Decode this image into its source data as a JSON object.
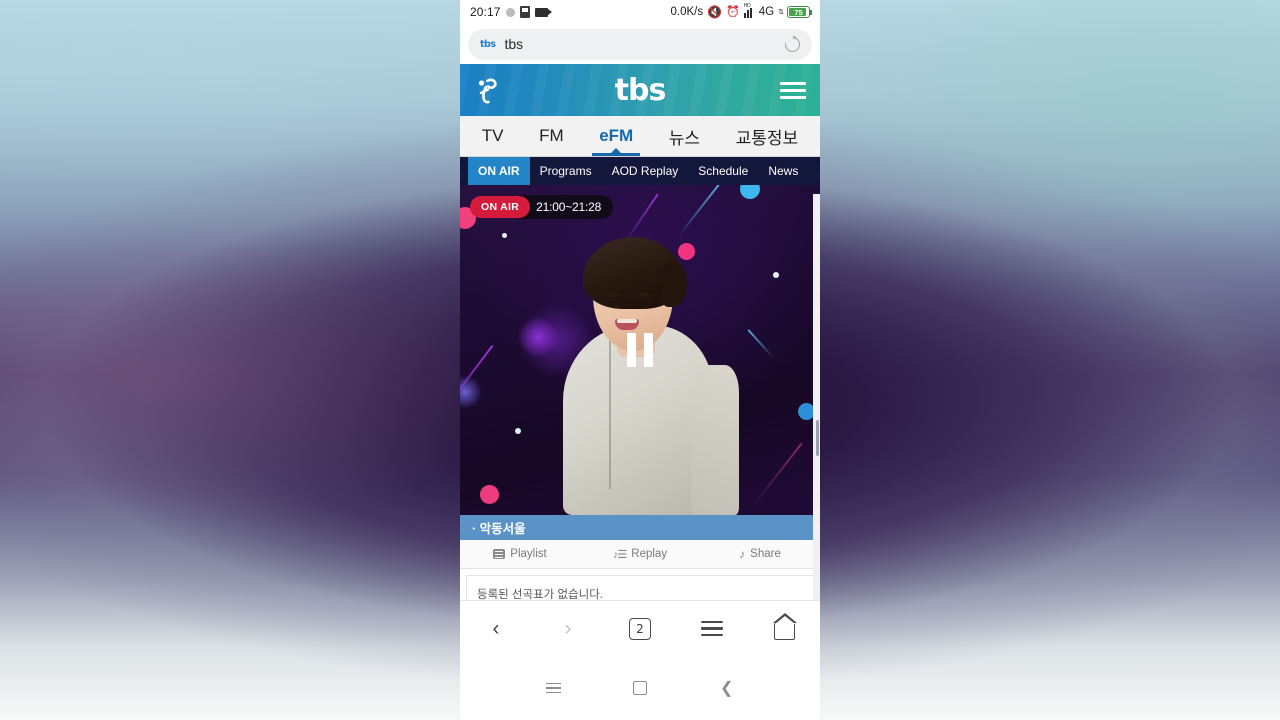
{
  "statusbar": {
    "clock": "20:17",
    "network_speed": "0.0K/s",
    "network_type": "4G",
    "battery_text": "75",
    "icons": [
      "record-dot-icon",
      "sd-card-icon",
      "screen-record-icon",
      "mute-icon",
      "alarm-icon",
      "signal-bars-icon",
      "hd-label",
      "data-arrows-icon",
      "battery-icon"
    ]
  },
  "browser": {
    "url_favicon_text": "tbs",
    "url_text": "tbs",
    "reload_label": "reload-icon",
    "toolbar": {
      "back": "‹",
      "forward": "›",
      "tab_count": "2",
      "menu_label": "menu",
      "home_label": "home"
    }
  },
  "site": {
    "brand": "tbs",
    "logo_alt": "tbs-figure-logo",
    "menu_label": "hamburger-menu",
    "accent_blue": "#1669ad",
    "header_gradient_from": "#1b7fc4",
    "header_gradient_to": "#2bb195"
  },
  "mainnav": {
    "items": [
      {
        "label": "TV",
        "active": false
      },
      {
        "label": "FM",
        "active": false
      },
      {
        "label": "eFM",
        "active": true
      },
      {
        "label": "뉴스",
        "active": false
      },
      {
        "label": "교통정보",
        "active": false
      }
    ]
  },
  "subnav": {
    "items": [
      {
        "label": "ON AIR",
        "active": true
      },
      {
        "label": "Programs",
        "active": false
      },
      {
        "label": "AOD Replay",
        "active": false
      },
      {
        "label": "Schedule",
        "active": false
      },
      {
        "label": "News",
        "active": false
      }
    ]
  },
  "player": {
    "onair_badge": "ON AIR",
    "time_range": "21:00~21:28",
    "state": "playing",
    "pause_label": "pause-button",
    "program_title": "· 악동서울",
    "actions": [
      {
        "label": "Playlist",
        "icon": "playlist-icon"
      },
      {
        "label": "Replay",
        "icon": "replay-icon"
      },
      {
        "label": "Share",
        "icon": "share-icon"
      }
    ]
  },
  "playlist": {
    "empty_message": "등록된 선곡표가 없습니다."
  },
  "androidnav": {
    "recents": "recents-button",
    "home": "home-button",
    "back": "back-button"
  }
}
